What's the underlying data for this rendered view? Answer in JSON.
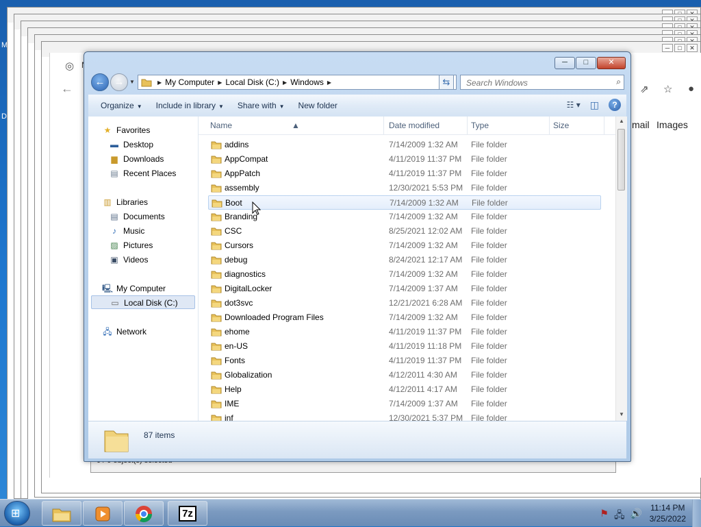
{
  "desktop": {
    "left_text_1": "M",
    "left_text_2": "D"
  },
  "chrome": {
    "partial_title": "N",
    "link_gmail": "mail",
    "link_images": "Images"
  },
  "sevenzip": {
    "status": "0 / 0 object(s) selected"
  },
  "window": {
    "minimize": "─",
    "maximize": "□",
    "close": "✕"
  },
  "address": {
    "crumbs": [
      "My Computer",
      "Local Disk (C:)",
      "Windows"
    ],
    "search_placeholder": "Search Windows"
  },
  "toolbar": {
    "organize": "Organize",
    "include_in_library": "Include in library",
    "share_with": "Share with",
    "new_folder": "New folder"
  },
  "nav": {
    "favorites": "Favorites",
    "desktop": "Desktop",
    "downloads": "Downloads",
    "recent_places": "Recent Places",
    "libraries": "Libraries",
    "documents": "Documents",
    "music": "Music",
    "pictures": "Pictures",
    "videos": "Videos",
    "my_computer": "My Computer",
    "local_disk": "Local Disk (C:)",
    "network": "Network"
  },
  "columns": {
    "name": "Name",
    "date_modified": "Date modified",
    "type": "Type",
    "size": "Size"
  },
  "files": [
    {
      "name": "addins",
      "date": "7/14/2009 1:32 AM",
      "type": "File folder"
    },
    {
      "name": "AppCompat",
      "date": "4/11/2019 11:37 PM",
      "type": "File folder"
    },
    {
      "name": "AppPatch",
      "date": "4/11/2019 11:37 PM",
      "type": "File folder"
    },
    {
      "name": "assembly",
      "date": "12/30/2021 5:53 PM",
      "type": "File folder"
    },
    {
      "name": "Boot",
      "date": "7/14/2009 1:32 AM",
      "type": "File folder"
    },
    {
      "name": "Branding",
      "date": "7/14/2009 1:32 AM",
      "type": "File folder"
    },
    {
      "name": "CSC",
      "date": "8/25/2021 12:02 AM",
      "type": "File folder"
    },
    {
      "name": "Cursors",
      "date": "7/14/2009 1:32 AM",
      "type": "File folder"
    },
    {
      "name": "debug",
      "date": "8/24/2021 12:17 AM",
      "type": "File folder"
    },
    {
      "name": "diagnostics",
      "date": "7/14/2009 1:32 AM",
      "type": "File folder"
    },
    {
      "name": "DigitalLocker",
      "date": "7/14/2009 1:37 AM",
      "type": "File folder"
    },
    {
      "name": "dot3svc",
      "date": "12/21/2021 6:28 AM",
      "type": "File folder"
    },
    {
      "name": "Downloaded Program Files",
      "date": "7/14/2009 1:32 AM",
      "type": "File folder"
    },
    {
      "name": "ehome",
      "date": "4/11/2019 11:37 PM",
      "type": "File folder"
    },
    {
      "name": "en-US",
      "date": "4/11/2019 11:18 PM",
      "type": "File folder"
    },
    {
      "name": "Fonts",
      "date": "4/11/2019 11:37 PM",
      "type": "File folder"
    },
    {
      "name": "Globalization",
      "date": "4/12/2011 4:30 AM",
      "type": "File folder"
    },
    {
      "name": "Help",
      "date": "4/12/2011 4:17 AM",
      "type": "File folder"
    },
    {
      "name": "IME",
      "date": "7/14/2009 1:37 AM",
      "type": "File folder"
    },
    {
      "name": "inf",
      "date": "12/30/2021 5:37 PM",
      "type": "File folder"
    }
  ],
  "details": {
    "item_count": "87 items"
  },
  "taskbar": {
    "sevenzip_label": "7z",
    "time": "11:14 PM",
    "date": "3/25/2022"
  },
  "colors": {
    "accent": "#2b63b3",
    "folder": "#e8c15a",
    "hover_row": "#e4eefb"
  }
}
